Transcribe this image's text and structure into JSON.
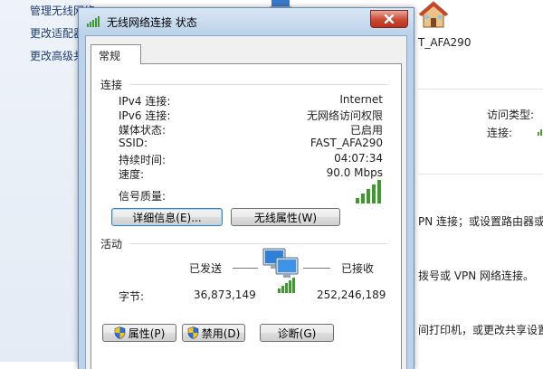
{
  "background": {
    "sidebar_links": [
      "管理无线网络",
      "更改适配器",
      "更改高级共"
    ],
    "network_name": "T_AFA290",
    "access_type_label": "访问类型:",
    "connection_label": "连接:",
    "snippets": [
      "PN 连接；或设置路由器或",
      "拨号或 VPN 网络连接。",
      "间打印机，或更改共享设置"
    ]
  },
  "dialog": {
    "title": "无线网络连接 状态",
    "tab_label": "常规",
    "connection": {
      "heading": "连接",
      "rows": [
        {
          "label": "IPv4 连接:",
          "value": "Internet"
        },
        {
          "label": "IPv6 连接:",
          "value": "无网络访问权限"
        },
        {
          "label": "媒体状态:",
          "value": "已启用"
        },
        {
          "label": "SSID:",
          "value": "FAST_AFA290"
        },
        {
          "label": "持续时间:",
          "value": "04:07:34"
        },
        {
          "label": "速度:",
          "value": "90.0 Mbps"
        }
      ],
      "signal_label": "信号质量:",
      "signal_bars": 5,
      "details_button": "详细信息(E)...",
      "wireless_props_button": "无线属性(W)"
    },
    "activity": {
      "heading": "活动",
      "sent_label": "已发送",
      "received_label": "已接收",
      "bytes_label": "字节:",
      "bytes_sent": "36,873,149",
      "bytes_received": "252,246,189"
    },
    "buttons": {
      "properties": "属性(P)",
      "disable": "禁用(D)",
      "diagnose": "诊断(G)"
    }
  }
}
